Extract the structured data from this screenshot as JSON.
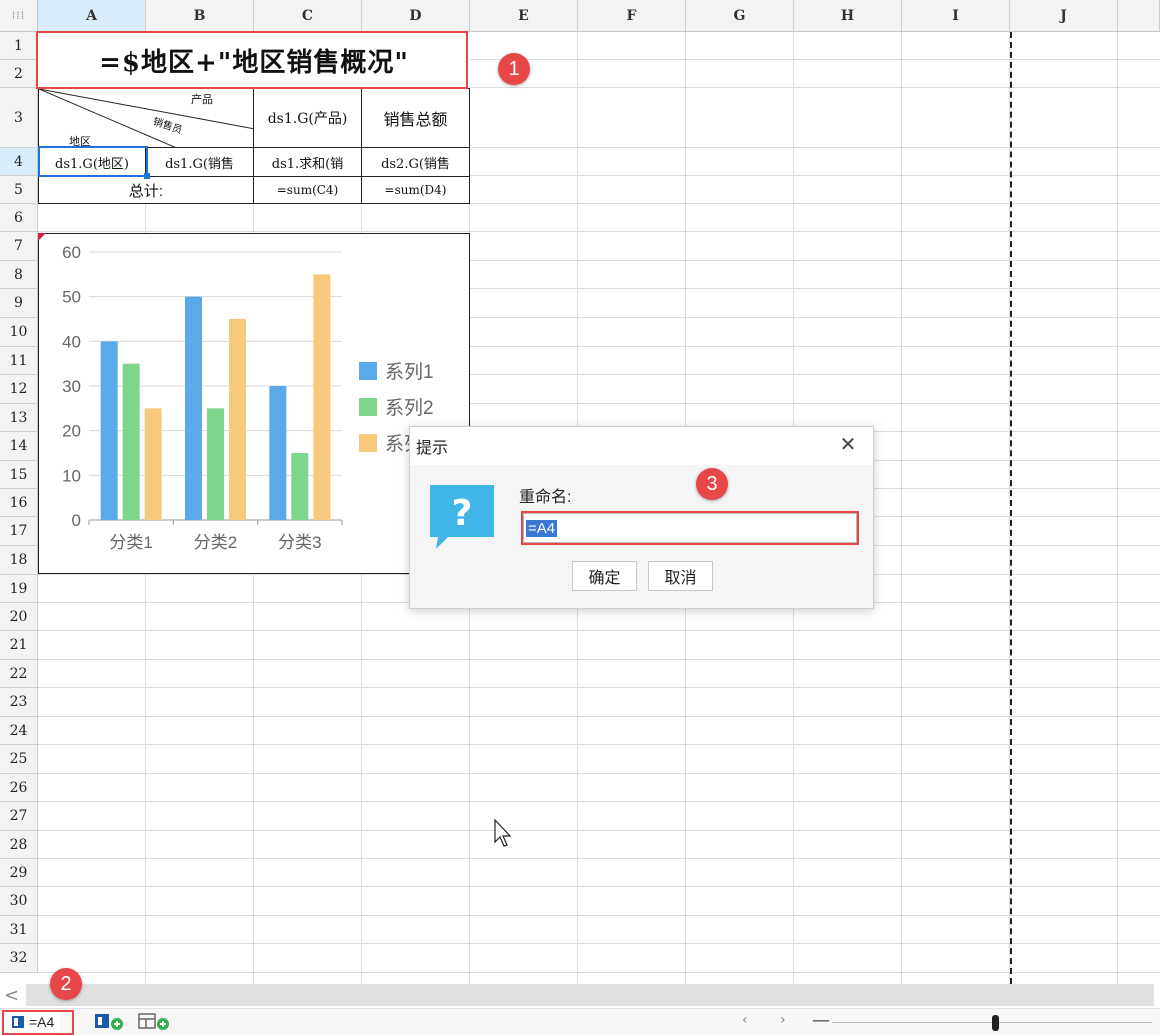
{
  "columns": [
    "A",
    "B",
    "C",
    "D",
    "E",
    "F",
    "G",
    "H",
    "I",
    "J"
  ],
  "rows": [
    "1",
    "2",
    "3",
    "4",
    "5",
    "6",
    "7",
    "8",
    "9",
    "10",
    "11",
    "12",
    "13",
    "14",
    "15",
    "16",
    "17",
    "18",
    "19",
    "20",
    "21",
    "22",
    "23",
    "24",
    "25",
    "26",
    "27",
    "28",
    "29",
    "30",
    "31",
    "32"
  ],
  "selected_column": "A",
  "selected_row": "4",
  "corner_icon": "grid-dots-icon",
  "report": {
    "title": "=$地区+\"地区销售概况\"",
    "slash_header": {
      "top": "产品",
      "middle": "销售员",
      "bottom": "地区"
    },
    "c3": "ds1.G(产品)",
    "d3": "销售总额",
    "a4": "ds1.G(地区)",
    "b4": "ds1.G(销售",
    "c4": "ds1.求和(销",
    "d4": "ds2.G(销售",
    "ab5": "总计:",
    "c5": "=sum(C4)",
    "d5": "=sum(D4)"
  },
  "chart_data": {
    "type": "bar",
    "categories": [
      "分类1",
      "分类2",
      "分类3"
    ],
    "series": [
      {
        "name": "系列1",
        "values": [
          40,
          50,
          30
        ],
        "color": "#5aaaea"
      },
      {
        "name": "系列2",
        "values": [
          35,
          25,
          15
        ],
        "color": "#7ed68c"
      },
      {
        "name": "系列3",
        "values": [
          25,
          45,
          55
        ],
        "color": "#f7c97a"
      }
    ],
    "ylim": [
      0,
      60
    ],
    "yticks": [
      "0",
      "10",
      "20",
      "30",
      "40",
      "50",
      "60"
    ],
    "grid": true,
    "legend": "right"
  },
  "dialog": {
    "title": "提示",
    "label": "重命名:",
    "input_value": "=A4",
    "ok": "确定",
    "cancel": "取消",
    "icon": "question-icon",
    "close_icon": "close-icon"
  },
  "annotations": [
    "1",
    "2",
    "3"
  ],
  "statusbar": {
    "sheet_tab": "=A4",
    "add_sheet_icon": "add-report-sheet-icon",
    "add_dashboard_icon": "add-dashboard-sheet-icon",
    "scroll_left": "‹",
    "scroll_right": "›",
    "zoom_minus": "—"
  },
  "scroll_left_arrow": "<",
  "colors": {
    "accent_selection": "#1e73d6",
    "annotation_red": "#e84747",
    "header_bg": "#f3f3f3",
    "selected_header_bg": "#d8ecf9",
    "dialog_icon_blue": "#3fb5e8"
  }
}
